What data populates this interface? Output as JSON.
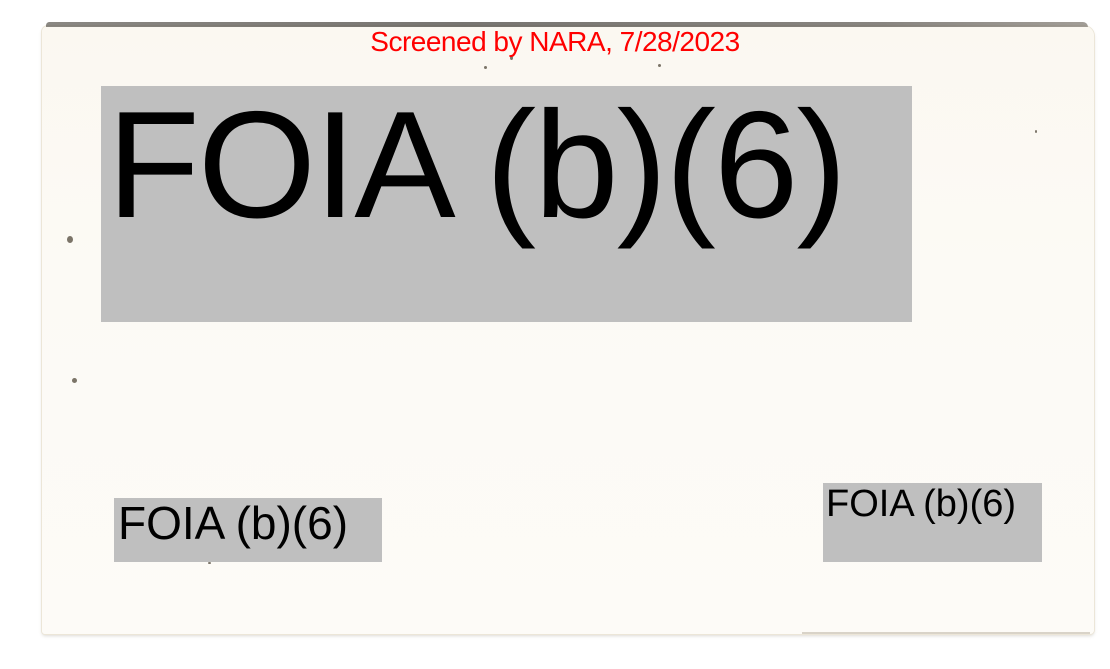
{
  "document": {
    "screening_stamp": "Screened by NARA, 7/28/2023",
    "stamp_color": "#ff0000",
    "redaction_color": "#bfbfbf",
    "redactions": [
      {
        "label": "FOIA (b)(6)"
      },
      {
        "label": "FOIA (b)(6)"
      },
      {
        "label": "FOIA (b)(6)"
      }
    ]
  }
}
